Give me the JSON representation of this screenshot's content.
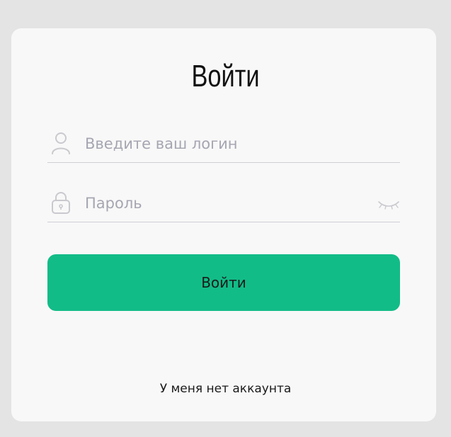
{
  "form": {
    "title": "Войти",
    "login": {
      "placeholder": "Введите ваш логин",
      "value": "",
      "icon": "user-icon"
    },
    "password": {
      "placeholder": "Пароль",
      "value": "",
      "icon": "lock-icon",
      "toggle_icon": "eye-closed-icon"
    },
    "submit_label": "Войти",
    "no_account_link": "У меня нет аккаунта"
  },
  "colors": {
    "page_background": "#e4e4e4",
    "card_background": "#f8f8f8",
    "accent": "#12bc87",
    "placeholder": "#a6a6b2",
    "divider": "#cfcfd4"
  }
}
